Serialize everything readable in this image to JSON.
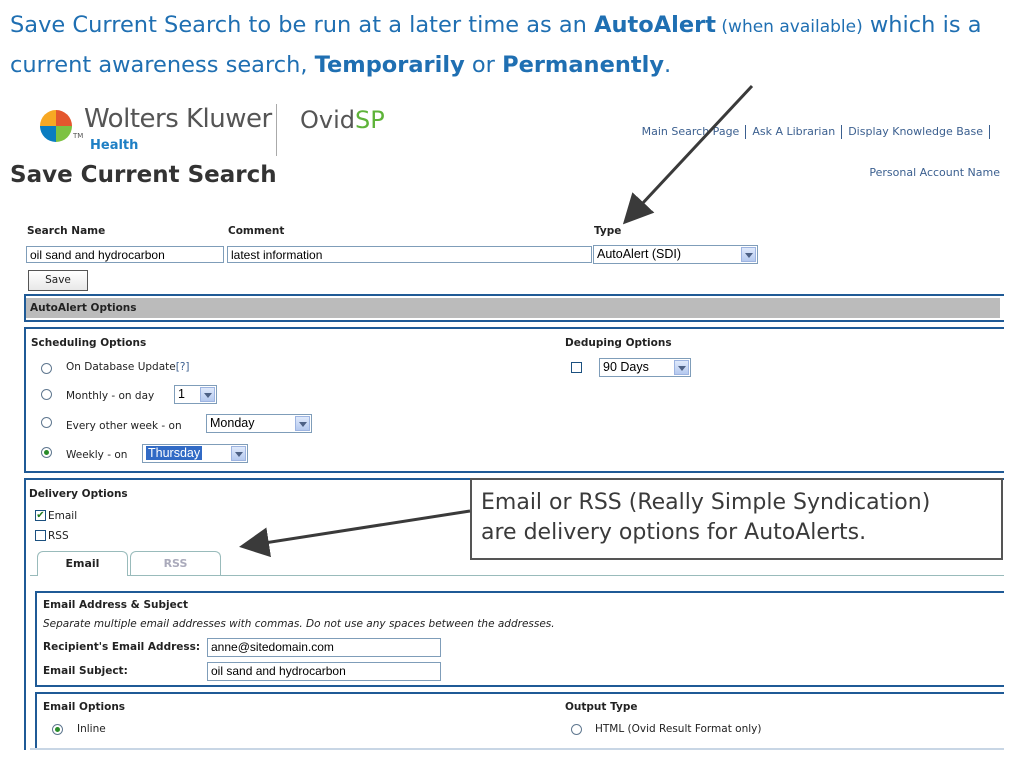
{
  "caption": {
    "p1": "Save Current Search",
    "p2": " to be run at a later time ",
    "p3": "as an ",
    "p4": "AutoAlert",
    "p5": " (when available)",
    "p6": " which is a current awareness search, ",
    "p7": "Temporarily",
    "p8": " or ",
    "p9": "Permanently",
    "p10": "."
  },
  "brand": {
    "company": "Wolters Kluwer",
    "division": "Health",
    "tm": "TM",
    "product_a": "Ovid",
    "product_b": "SP"
  },
  "topnav": [
    "Main Search Page",
    "Ask A Librarian",
    "Display Knowledge Base"
  ],
  "page_title": "Save Current Search",
  "account_name": "Personal Account Name",
  "form": {
    "search_name_label": "Search Name",
    "comment_label": "Comment",
    "type_label": "Type",
    "search_name_value": "oil sand and hydrocarbon",
    "comment_value": "latest information",
    "type_value": "AutoAlert (SDI)",
    "save_label": "Save"
  },
  "autoalert": {
    "header": "AutoAlert Options",
    "scheduling_label": "Scheduling Options",
    "deduping_label": "Deduping Options",
    "deduping_value": "90 Days",
    "options": {
      "db_update": "On Database Update",
      "help": "[?]",
      "monthly": "Monthly - on day",
      "monthly_value": "1",
      "every_other": "Every other week - on",
      "every_other_value": "Monday",
      "weekly": "Weekly - on",
      "weekly_value": "Thursday"
    }
  },
  "delivery": {
    "label": "Delivery Options",
    "email": "Email",
    "rss": "RSS",
    "tabs": [
      "Email",
      "RSS"
    ]
  },
  "callout": {
    "line1": "Email or RSS (Really Simple Syndication)",
    "line2": "are delivery options for AutoAlerts."
  },
  "email_section": {
    "header": "Email Address & Subject",
    "note": "Separate multiple email addresses with commas. Do not use any spaces between the addresses.",
    "recipient_label": "Recipient's Email Address:",
    "recipient_value": "anne@sitedomain.com",
    "subject_label": "Email Subject:",
    "subject_value": "oil sand and hydrocarbon"
  },
  "email_options": {
    "label": "Email Options",
    "inline": "Inline",
    "output_label": "Output Type",
    "html_option": "HTML (Ovid Result Format only)"
  },
  "colors": {
    "caption": "#1f6fb2",
    "panel_border": "#1f5a96",
    "link": "#3b5f8f",
    "arrow": "#3a3a3a"
  }
}
